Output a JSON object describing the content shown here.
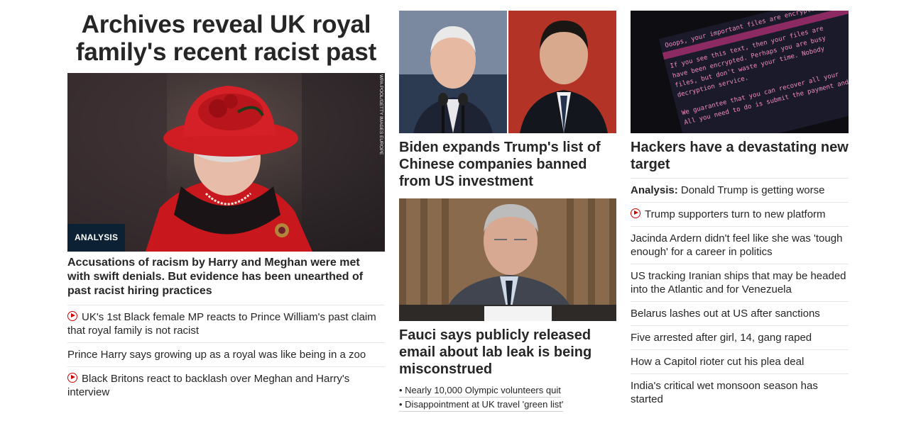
{
  "left": {
    "hero_title": "Archives reveal UK royal family's recent racist past",
    "image_credit": "WPA POOL/GETTY IMAGES EUROPE",
    "badge": "ANALYSIS",
    "subhead": "Accusations of racism by Harry and Meghan were met with swift denials. But evidence has been unearthed of past racist hiring practices",
    "links": [
      {
        "text": "UK's 1st Black female MP reacts to Prince William's past claim that royal family is not racist",
        "video": true
      },
      {
        "text": "Prince Harry says growing up as a royal was like being in a zoo",
        "video": false
      },
      {
        "text": "Black Britons react to backlash over Meghan and Harry's interview",
        "video": true
      }
    ]
  },
  "middle": {
    "story1_headline": "Biden expands Trump's list of Chinese companies banned from US investment",
    "story2_headline": "Fauci says publicly released email about lab leak is being misconstrued",
    "bullets": [
      "• Nearly 10,000 Olympic volunteers quit",
      "• Disappointment at UK travel 'green list'"
    ]
  },
  "right": {
    "headline": "Hackers have a devastating new target",
    "screen_text": [
      "Ooops, your important files are encrypted.",
      "If you see this text, then your files are",
      "have been encrypted. Perhaps you are busy",
      "files, but don't waste your time. Nobody",
      "decryption service.",
      "We guarantee that you can recover all your",
      "All you need to do is submit the payment and pu"
    ],
    "links": [
      {
        "prefix": "Analysis:",
        "text": " Donald Trump is getting worse",
        "video": false
      },
      {
        "prefix": "",
        "text": "Trump supporters turn to new platform",
        "video": true
      },
      {
        "prefix": "",
        "text": "Jacinda Ardern didn't feel like she was 'tough enough' for a career in politics",
        "video": false
      },
      {
        "prefix": "",
        "text": "US tracking Iranian ships that may be headed into the Atlantic and for Venezuela",
        "video": false
      },
      {
        "prefix": "",
        "text": "Belarus lashes out at US after sanctions",
        "video": false
      },
      {
        "prefix": "",
        "text": "Five arrested after girl, 14, gang raped",
        "video": false
      },
      {
        "prefix": "",
        "text": "How a Capitol rioter cut his plea deal",
        "video": false
      },
      {
        "prefix": "",
        "text": "India's critical wet monsoon season has started",
        "video": false
      }
    ]
  }
}
